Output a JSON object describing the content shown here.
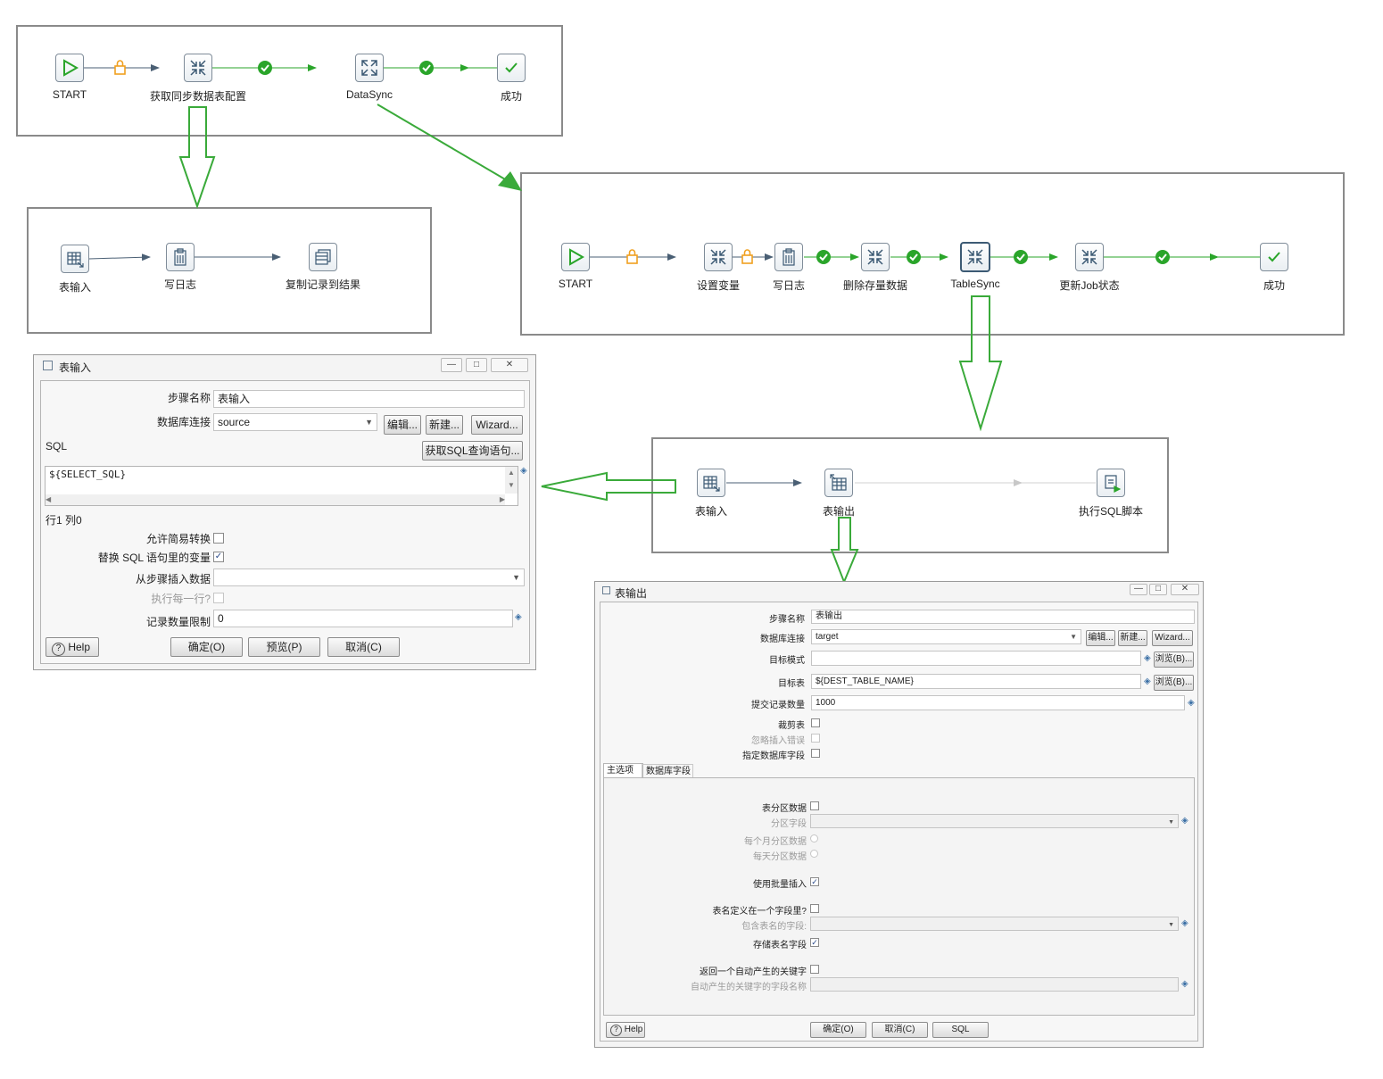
{
  "job_main": {
    "nodes": [
      {
        "label": "START",
        "icon": "start-icon"
      },
      {
        "label": "获取同步数据表配置",
        "icon": "transformation-icon"
      },
      {
        "label": "DataSync",
        "icon": "job-icon"
      },
      {
        "label": "成功",
        "icon": "success-icon"
      }
    ]
  },
  "trans_config": {
    "nodes": [
      {
        "label": "表输入",
        "icon": "table-input-icon"
      },
      {
        "label": "写日志",
        "icon": "write-log-icon"
      },
      {
        "label": "复制记录到结果",
        "icon": "copy-rows-icon"
      }
    ]
  },
  "job_sync": {
    "nodes": [
      {
        "label": "START",
        "icon": "start-icon"
      },
      {
        "label": "设置变量",
        "icon": "set-variables-icon"
      },
      {
        "label": "写日志",
        "icon": "write-log-icon"
      },
      {
        "label": "删除存量数据",
        "icon": "transformation-icon"
      },
      {
        "label": "TableSync",
        "icon": "transformation-icon"
      },
      {
        "label": "更新Job状态",
        "icon": "transformation-icon"
      },
      {
        "label": "成功",
        "icon": "success-icon"
      }
    ]
  },
  "trans_tablesync": {
    "nodes": [
      {
        "label": "表输入",
        "icon": "table-input-icon"
      },
      {
        "label": "表输出",
        "icon": "table-output-icon"
      },
      {
        "label": "执行SQL脚本",
        "icon": "sql-script-icon"
      }
    ]
  },
  "dialog_input": {
    "title": "表输入",
    "step_name_label": "步骤名称",
    "step_name_value": "表输入",
    "db_conn_label": "数据库连接",
    "db_conn_value": "source",
    "edit_btn": "编辑...",
    "new_btn": "新建...",
    "wizard_btn": "Wizard...",
    "sql_label": "SQL",
    "get_sql_btn": "获取SQL查询语句...",
    "sql_text": "${SELECT_SQL}",
    "cursor_pos": "行1 列0",
    "lazy_conv_label": "允许简易转换",
    "replace_vars_label": "替换 SQL 语句里的变量",
    "insert_from_step_label": "从步骤插入数据",
    "exec_each_row_label": "执行每一行?",
    "limit_label": "记录数量限制",
    "limit_value": "0",
    "help_btn": "Help",
    "ok_btn": "确定(O)",
    "preview_btn": "预览(P)",
    "cancel_btn": "取消(C)"
  },
  "dialog_output": {
    "title": "表输出",
    "step_name_label": "步骤名称",
    "step_name_value": "表输出",
    "db_conn_label": "数据库连接",
    "db_conn_value": "target",
    "edit_btn": "编辑...",
    "new_btn": "新建...",
    "wizard_btn": "Wizard...",
    "schema_label": "目标模式",
    "browse_btn": "浏览(B)...",
    "table_label": "目标表",
    "table_value": "${DEST_TABLE_NAME}",
    "commit_label": "提交记录数量",
    "commit_value": "1000",
    "truncate_label": "裁剪表",
    "ignore_errors_label": "忽略插入错误",
    "specify_fields_label": "指定数据库字段",
    "tab_main": "主选项",
    "tab_fields": "数据库字段",
    "partition_label": "表分区数据",
    "partition_field_label": "分区字段",
    "partition_month_label": "每个月分区数据",
    "partition_day_label": "每天分区数据",
    "batch_label": "使用批量插入",
    "table_in_field_label": "表名定义在一个字段里?",
    "table_field_label": "包含表名的字段:",
    "store_table_name_label": "存储表名字段",
    "return_key_label": "返回一个自动产生的关键字",
    "key_field_label": "自动产生的关键字的字段名称",
    "help_btn": "Help",
    "ok_btn": "确定(O)",
    "cancel_btn": "取消(C)",
    "sql_btn": "SQL"
  },
  "colors": {
    "green": "#2aa52a",
    "hop_blue": "#4a5f74",
    "lock_orange": "#f0a020",
    "arrow_green": "#3aaa3a"
  }
}
